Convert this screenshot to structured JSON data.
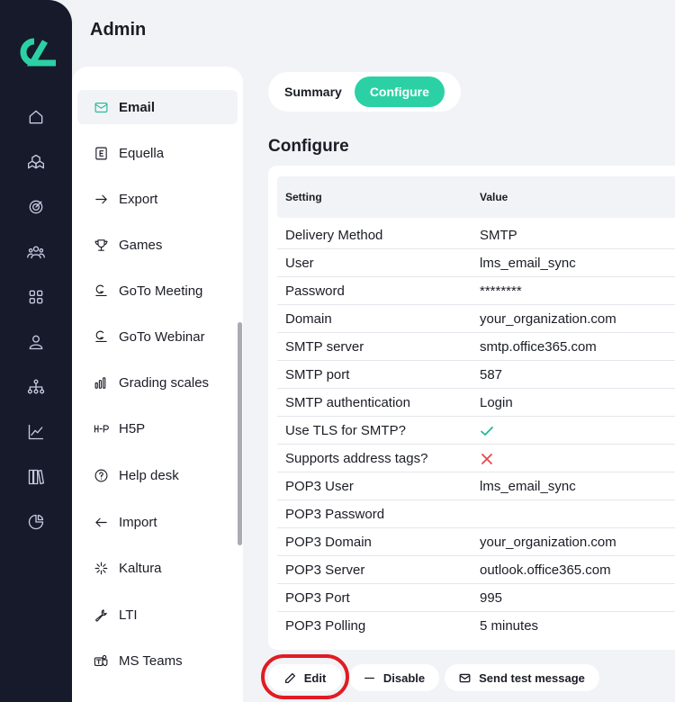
{
  "header": {
    "title": "Admin"
  },
  "rail": {
    "icons": [
      "home-icon",
      "cubes-icon",
      "target-icon",
      "users-icon",
      "grid-icon",
      "user-icon",
      "org-chart-icon",
      "line-chart-icon",
      "library-icon",
      "pie-chart-icon"
    ]
  },
  "sidebar": {
    "items": [
      {
        "label": "Email",
        "icon": "mail-icon",
        "active": true
      },
      {
        "label": "Equella",
        "icon": "equella-icon"
      },
      {
        "label": "Export",
        "icon": "arrow-right-icon"
      },
      {
        "label": "Games",
        "icon": "trophy-icon"
      },
      {
        "label": "GoTo Meeting",
        "icon": "goto-icon"
      },
      {
        "label": "GoTo Webinar",
        "icon": "goto-icon"
      },
      {
        "label": "Grading scales",
        "icon": "bar-chart-icon"
      },
      {
        "label": "H5P",
        "icon": "h5p-icon"
      },
      {
        "label": "Help desk",
        "icon": "help-icon"
      },
      {
        "label": "Import",
        "icon": "arrow-left-icon"
      },
      {
        "label": "Kaltura",
        "icon": "kaltura-icon"
      },
      {
        "label": "LTI",
        "icon": "wrench-icon"
      },
      {
        "label": "MS Teams",
        "icon": "teams-icon"
      }
    ]
  },
  "tabs": [
    {
      "label": "Summary",
      "active": false
    },
    {
      "label": "Configure",
      "active": true
    }
  ],
  "section": {
    "title": "Configure"
  },
  "table": {
    "columns": [
      "Setting",
      "Value"
    ],
    "rows": [
      {
        "setting": "Delivery Method",
        "value": "SMTP"
      },
      {
        "setting": "User",
        "value": "lms_email_sync"
      },
      {
        "setting": "Password",
        "value": "********"
      },
      {
        "setting": "Domain",
        "value": "your_organization.com"
      },
      {
        "setting": "SMTP server",
        "value": "smtp.office365.com"
      },
      {
        "setting": "SMTP port",
        "value": "587"
      },
      {
        "setting": "SMTP authentication",
        "value": "Login"
      },
      {
        "setting": "Use TLS for SMTP?",
        "value": "",
        "icon": "check-icon"
      },
      {
        "setting": "Supports address tags?",
        "value": "",
        "icon": "x-icon"
      },
      {
        "setting": "POP3 User",
        "value": "lms_email_sync"
      },
      {
        "setting": "POP3 Password",
        "value": ""
      },
      {
        "setting": "POP3 Domain",
        "value": "your_organization.com"
      },
      {
        "setting": "POP3 Server",
        "value": "outlook.office365.com"
      },
      {
        "setting": "POP3 Port",
        "value": "995"
      },
      {
        "setting": "POP3 Polling",
        "value": "5 minutes"
      }
    ]
  },
  "actions": {
    "edit_label": "Edit",
    "disable_label": "Disable",
    "send_label": "Send test message"
  },
  "colors": {
    "accent": "#2bd1a5",
    "rail": "#161a2b",
    "check": "#1fb896",
    "cross": "#e5484d",
    "highlight": "#e21b22"
  }
}
